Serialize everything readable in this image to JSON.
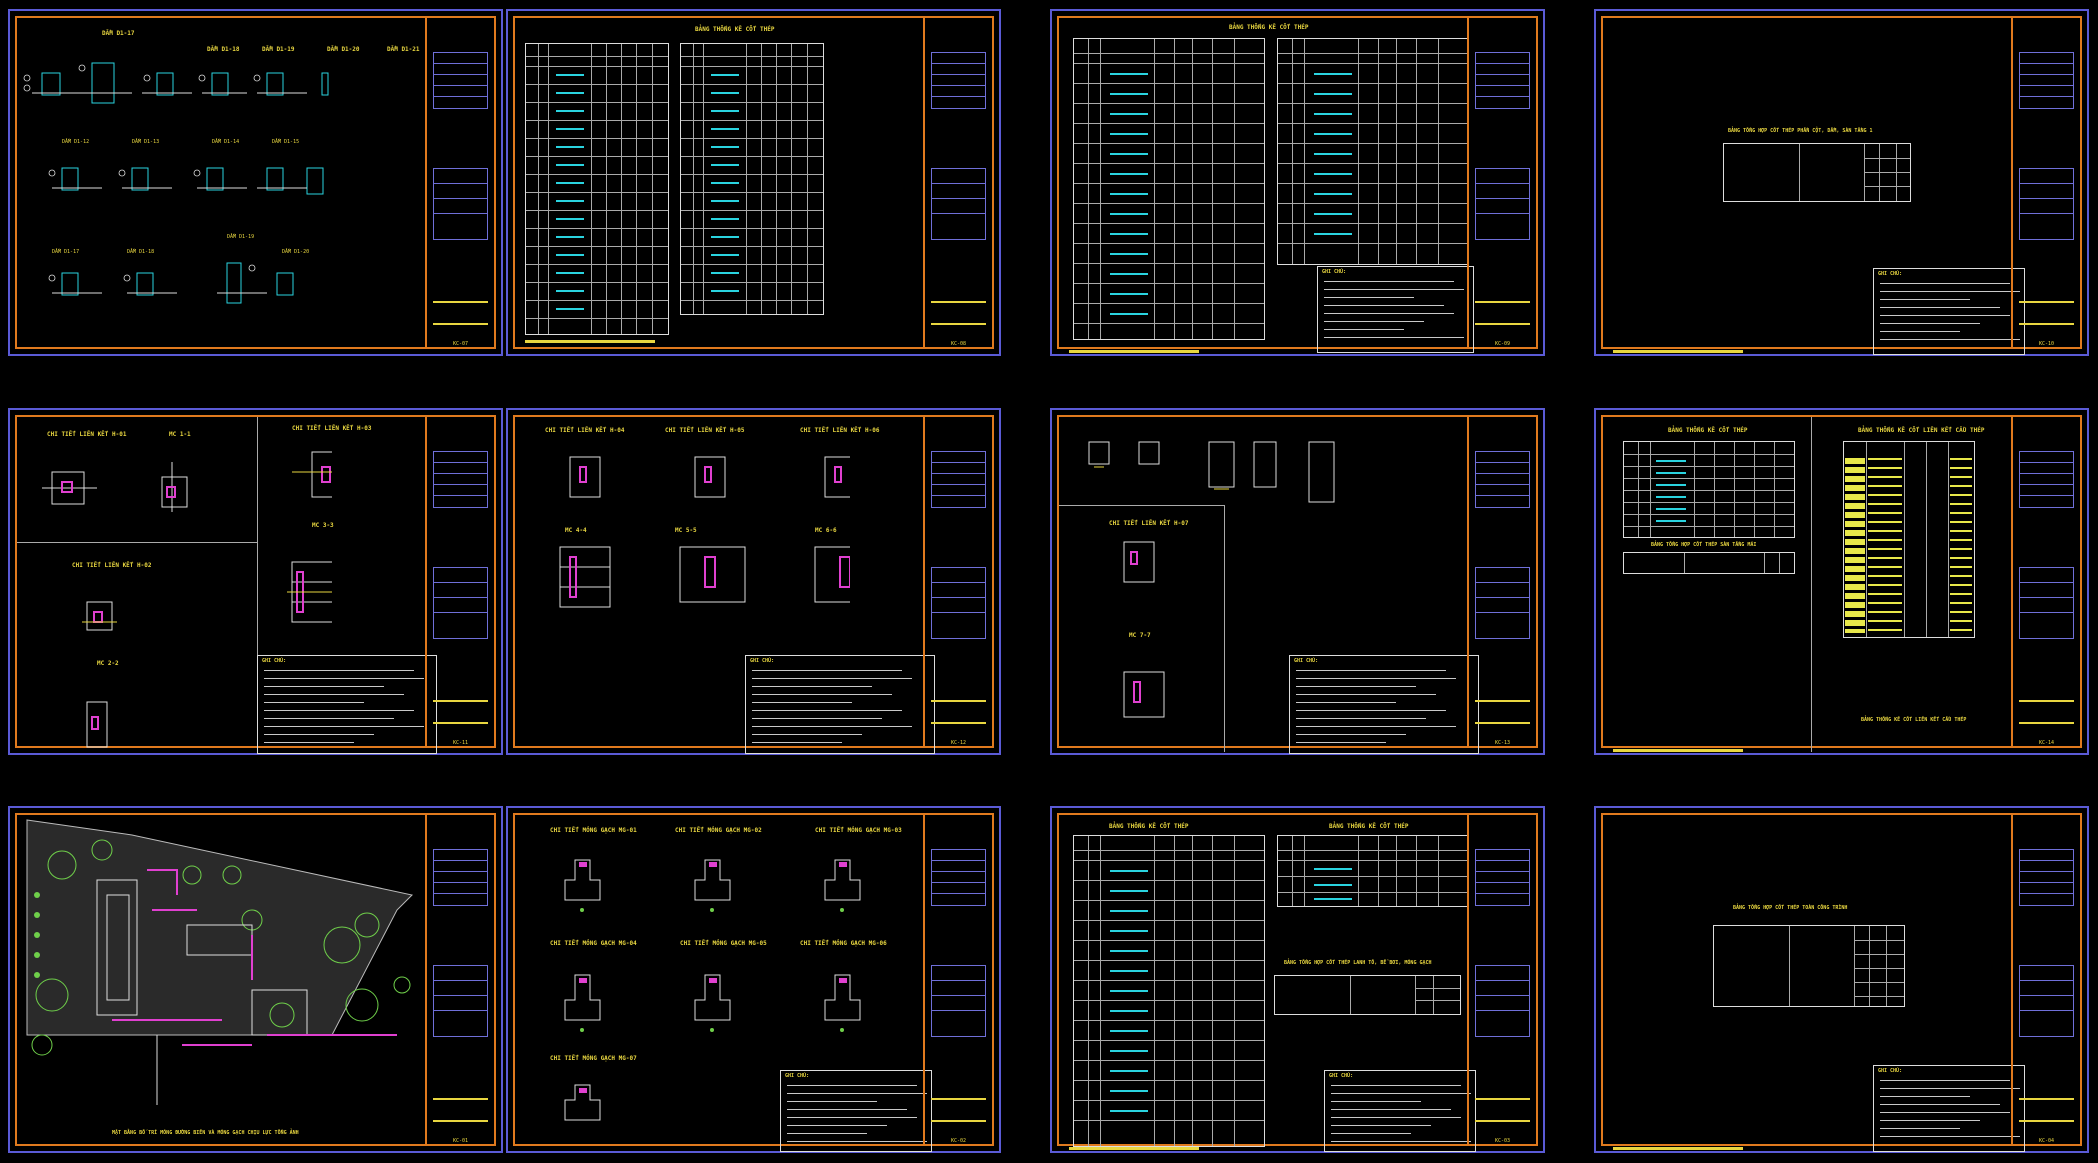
{
  "sheets": [
    {
      "id": "s1",
      "title": "DẦM D1-17",
      "kind": "beam-sections",
      "code": "KC-07"
    },
    {
      "id": "s2",
      "title": "BẢNG THỐNG KÊ CỐT THÉP",
      "kind": "rebar-tables",
      "code": "KC-08"
    },
    {
      "id": "s3",
      "title": "BẢNG THỐNG KÊ CỐT THÉP",
      "kind": "rebar-tables-notes",
      "code": "KC-09"
    },
    {
      "id": "s4",
      "title": "BẢNG TỔNG HỢP CỐT THÉP PHẦN CỘT, DẦM, SÀN TẦNG 1",
      "kind": "summary",
      "code": "KC-10"
    },
    {
      "id": "s5",
      "title": "CHI TIẾT LIÊN KẾT H-01",
      "kind": "connections",
      "code": "KC-11"
    },
    {
      "id": "s6",
      "title": "CHI TIẾT LIÊN KẾT H-04",
      "kind": "connections",
      "code": "KC-12"
    },
    {
      "id": "s7",
      "title": "CHI TIẾT LIÊN KẾT H-07",
      "kind": "connections",
      "code": "KC-13"
    },
    {
      "id": "s8",
      "title": "BẢNG THỐNG KÊ CỐT THÉP",
      "kind": "rebar-yellow",
      "code": "KC-14"
    },
    {
      "id": "s9",
      "title": "MẶT BẰNG BỐ TRÍ MÓNG ĐƯỜNG BIÊN VÀ MÓNG GẠCH CHỊU LỰC TỔNG ẢNH",
      "kind": "site-plan",
      "code": "KC-01"
    },
    {
      "id": "s10",
      "title": "CHI TIẾT MÓNG GẠCH MG-01",
      "kind": "foundations",
      "code": "KC-02"
    },
    {
      "id": "s11",
      "title": "BẢNG THỐNG KÊ CỐT THÉP",
      "kind": "rebar-tables-notes",
      "code": "KC-03"
    },
    {
      "id": "s12",
      "title": "BẢNG TỔNG HỢP CỐT THÉP TOÀN CÔNG TRÌNH",
      "kind": "summary",
      "code": "KC-04"
    }
  ],
  "labels": {
    "notes_title": "GHI CHÚ:",
    "s5_sub": "MC 1-1",
    "s5_sub2": "CHI TIẾT LIÊN KẾT H-03",
    "s5_sub3": "CHI TIẾT LIÊN KẾT H-02",
    "s5_sub4": "MC 2-2",
    "s5_sub5": "MC 3-3",
    "s6_sub": "CHI TIẾT LIÊN KẾT H-05",
    "s6_sub2": "CHI TIẾT LIÊN KẾT H-06",
    "s6_sub3": "MC 4-4",
    "s6_sub4": "MC 5-5",
    "s6_sub5": "MC 6-6",
    "s7_sub": "MC 7-7",
    "s8_sub": "BẢNG THỐNG KÊ CỐT THÉP",
    "s8_sub2": "BẢNG THỐNG KÊ CỐT LIÊN KẾT CẦU THÉP",
    "s8_sub3": "BẢNG TỔNG HỢP CỐT THÉP SÀN TẦNG MÁI",
    "s10_a": "CHI TIẾT MÓNG GẠCH MG-02",
    "s10_b": "CHI TIẾT MÓNG GẠCH MG-03",
    "s10_c": "CHI TIẾT MÓNG GẠCH MG-04",
    "s10_d": "CHI TIẾT MÓNG GẠCH MG-05",
    "s10_e": "CHI TIẾT MÓNG GẠCH MG-06",
    "s10_f": "CHI TIẾT MÓNG GẠCH MG-07",
    "s11_sub": "BẢNG TỔNG HỢP CỐT THÉP LANH TÔ, BỂ BƠI, MÓNG GẠCH",
    "s2_b": "BẢNG THỐNG KÊ CỐT THÉP",
    "s11_b": "BẢNG THỐNG KÊ CỐT THÉP",
    "s1_b": "DẦM D1-18",
    "s1_c": "DẦM D1-19",
    "s1_d": "DẦM D1-20",
    "s1_e": "DẦM D1-21"
  },
  "colors": {
    "sheet_border": "#5b5bd6",
    "frame": "#e07a1e",
    "text": "#e8d640",
    "rebar": "#2ad4e0",
    "highlight": "#e040d0",
    "tree": "#6fcf4a"
  }
}
